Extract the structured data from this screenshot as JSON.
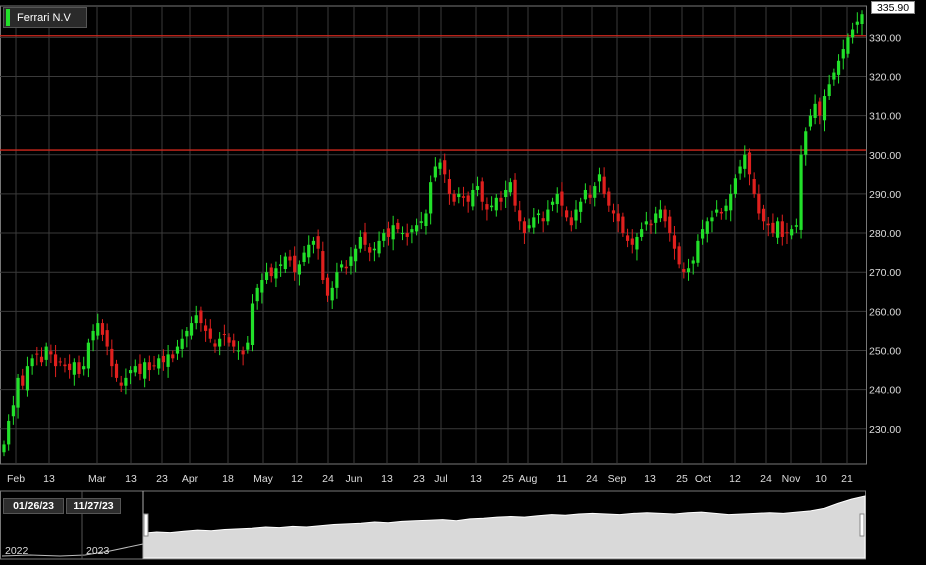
{
  "legend": {
    "label": "Ferrari N.V",
    "color": "#22e02a"
  },
  "last_price": "335.90",
  "navigator": {
    "range_start": "01/26/23",
    "range_end": "11/27/23",
    "years": [
      "2022",
      "2023"
    ]
  },
  "colors": {
    "up": "#22e02a",
    "down": "#e0201e",
    "reference_line": "#d0281e",
    "grid": "#3a3a3a",
    "background": "#000000"
  },
  "chart_data": {
    "type": "candlestick",
    "title": "",
    "series": [
      {
        "name": "Ferrari N.V"
      }
    ],
    "ylim": [
      221,
      338
    ],
    "yticks": [
      230,
      240,
      250,
      260,
      270,
      280,
      290,
      300,
      310,
      320,
      330
    ],
    "ytick_labels": [
      "230.00",
      "240.00",
      "250.00",
      "260.00",
      "270.00",
      "280.00",
      "290.00",
      "300.00",
      "310.00",
      "320.00",
      "330.00"
    ],
    "x_tick_labels": [
      "Feb",
      "13",
      "Mar",
      "13",
      "23",
      "Apr",
      "18",
      "May",
      "12",
      "24",
      "Jun",
      "13",
      "23",
      "Jul",
      "13",
      "25",
      "Aug",
      "11",
      "24",
      "Sep",
      "13",
      "25",
      "Oct",
      "12",
      "24",
      "Nov",
      "10",
      "21"
    ],
    "reference_lines": [
      330.4,
      301.2
    ],
    "closes": [
      226,
      232,
      236,
      243,
      241,
      246,
      248,
      249,
      247,
      251,
      249,
      246,
      247,
      246,
      245,
      247,
      244,
      246,
      252,
      255,
      257,
      254,
      251,
      246,
      243,
      241,
      243,
      245,
      246,
      244,
      247,
      245,
      246,
      248,
      247,
      249,
      248,
      251,
      253,
      255,
      257,
      259,
      257,
      255,
      253,
      251,
      253,
      254,
      252,
      251,
      250,
      249,
      252,
      262,
      266,
      268,
      270,
      269,
      271,
      272,
      274,
      273,
      270,
      272,
      275,
      277,
      278,
      276,
      268,
      264,
      266,
      270,
      272,
      271,
      274,
      276,
      279,
      277,
      275,
      276,
      278,
      280,
      279,
      282,
      281,
      280,
      279,
      281,
      282,
      283,
      285,
      293,
      297,
      298,
      295,
      290,
      288,
      290,
      289,
      288,
      291,
      292,
      288,
      286,
      287,
      289,
      288,
      291,
      293,
      287,
      283,
      280,
      282,
      284,
      285,
      283,
      286,
      288,
      290,
      287,
      284,
      282,
      286,
      288,
      291,
      289,
      292,
      295,
      290,
      287,
      285,
      283,
      280,
      278,
      277,
      279,
      281,
      283,
      282,
      285,
      286,
      283,
      280,
      276,
      272,
      270,
      271,
      273,
      278,
      281,
      283,
      284,
      286,
      285,
      287,
      290,
      294,
      297,
      300,
      295,
      290,
      285,
      283,
      282,
      280,
      283,
      279,
      280,
      281,
      282,
      300,
      306,
      310,
      313,
      310,
      315,
      318,
      321,
      324,
      327,
      330,
      332,
      334,
      335.9
    ],
    "volume_profile": [
      40,
      42,
      41,
      43,
      45,
      44,
      46,
      47,
      48,
      50,
      49,
      51,
      50,
      52,
      54,
      55,
      56,
      58,
      57,
      59,
      60,
      61,
      62,
      60,
      63,
      64,
      66,
      67,
      66,
      68,
      70,
      69,
      71,
      72,
      71,
      70,
      72,
      73,
      72,
      71,
      73,
      74,
      72,
      70,
      71,
      72,
      73,
      72,
      74,
      76,
      80,
      88,
      95,
      100
    ]
  }
}
